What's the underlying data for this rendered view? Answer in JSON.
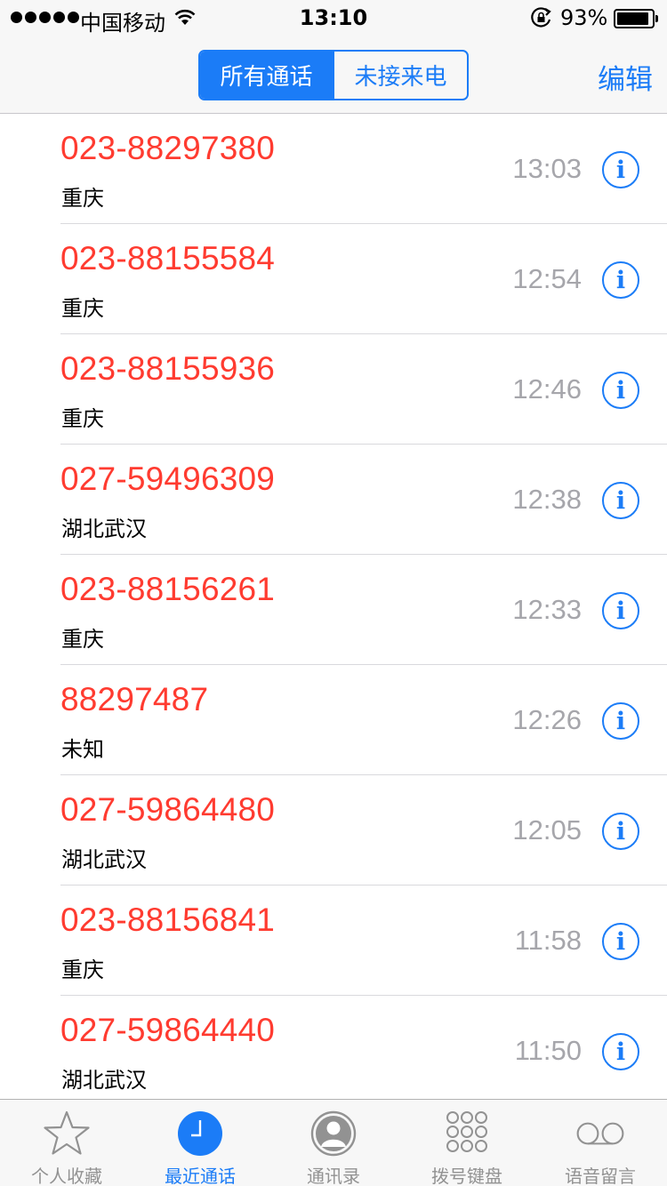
{
  "status_bar": {
    "carrier": "中国移动",
    "time": "13:10",
    "battery_percent": "93%",
    "battery_level": 0.93
  },
  "nav": {
    "segments": [
      "所有通话",
      "未接来电"
    ],
    "active_segment": 0,
    "edit_label": "编辑"
  },
  "calls": [
    {
      "number": "023-88297380",
      "location": "重庆",
      "time": "13:03"
    },
    {
      "number": "023-88155584",
      "location": "重庆",
      "time": "12:54"
    },
    {
      "number": "023-88155936",
      "location": "重庆",
      "time": "12:46"
    },
    {
      "number": "027-59496309",
      "location": "湖北武汉",
      "time": "12:38"
    },
    {
      "number": "023-88156261",
      "location": "重庆",
      "time": "12:33"
    },
    {
      "number": "88297487",
      "location": "未知",
      "time": "12:26"
    },
    {
      "number": "027-59864480",
      "location": "湖北武汉",
      "time": "12:05"
    },
    {
      "number": "023-88156841",
      "location": "重庆",
      "time": "11:58"
    },
    {
      "number": "027-59864440",
      "location": "湖北武汉",
      "time": "11:50"
    }
  ],
  "info_glyph": "i",
  "tabs": [
    {
      "label": "个人收藏",
      "icon": "star-icon"
    },
    {
      "label": "最近通话",
      "icon": "clock-icon"
    },
    {
      "label": "通讯录",
      "icon": "contacts-icon"
    },
    {
      "label": "拨号键盘",
      "icon": "keypad-icon"
    },
    {
      "label": "语音留言",
      "icon": "voicemail-icon"
    }
  ],
  "active_tab": 1,
  "colors": {
    "accent": "#1b7cf7",
    "missed_call": "#ff3b30",
    "time_gray": "#a6a6ab"
  }
}
